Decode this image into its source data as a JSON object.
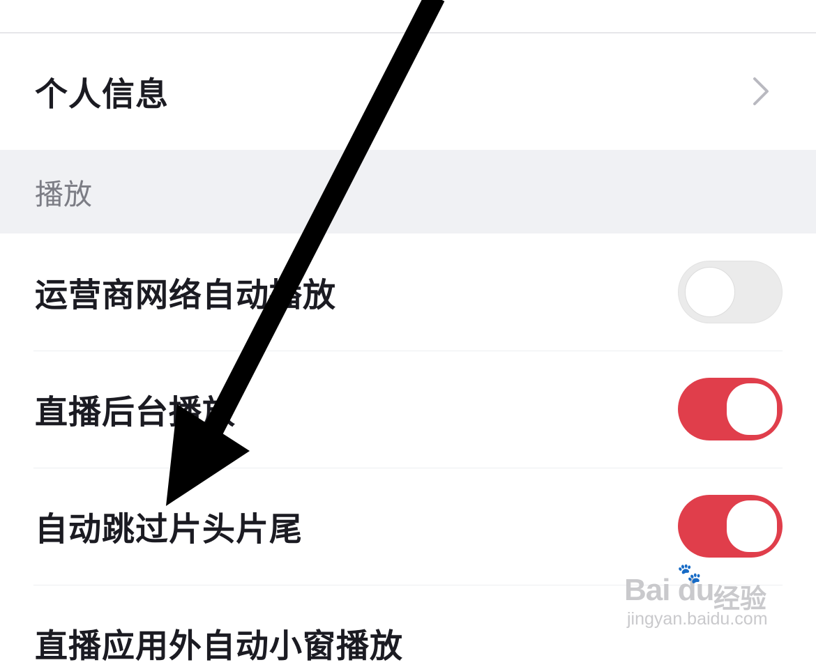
{
  "rows": {
    "personal_info": {
      "label": "个人信息"
    },
    "section_playback": {
      "label": "播放"
    },
    "carrier_autoplay": {
      "label": "运营商网络自动播放",
      "toggle": "off"
    },
    "live_background": {
      "label": "直播后台播放",
      "toggle": "on"
    },
    "skip_intro_outro": {
      "label": "自动跳过片头片尾",
      "toggle": "on"
    },
    "live_pip": {
      "label": "直播应用外自动小窗播放"
    }
  },
  "watermark": {
    "brand": "Bai du",
    "cn": "经验",
    "url": "jingyan.baidu.com"
  },
  "colors": {
    "toggle_on": "#e03e4b",
    "toggle_off": "#ebebeb",
    "section_bg": "#f0f1f4"
  }
}
